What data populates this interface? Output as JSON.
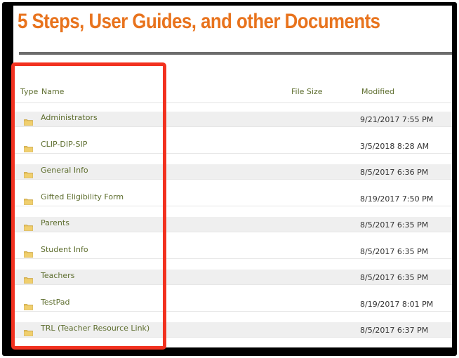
{
  "page": {
    "title": "5 Steps, User Guides, and other Documents"
  },
  "table": {
    "headers": {
      "type": "Type",
      "name": "Name",
      "file_size": "File Size",
      "modified": "Modified"
    },
    "rows": [
      {
        "icon": "folder-icon",
        "name": "Administrators",
        "file_size": "",
        "modified": "9/21/2017 7:55 PM"
      },
      {
        "icon": "folder-icon",
        "name": "CLIP-DIP-SIP",
        "file_size": "",
        "modified": "3/5/2018 8:28 AM"
      },
      {
        "icon": "folder-icon",
        "name": "General Info",
        "file_size": "",
        "modified": "8/5/2017 6:36 PM"
      },
      {
        "icon": "folder-icon",
        "name": "Gifted Eligibility Form",
        "file_size": "",
        "modified": "8/19/2017 7:50 PM"
      },
      {
        "icon": "folder-icon",
        "name": "Parents",
        "file_size": "",
        "modified": "8/5/2017 6:35 PM"
      },
      {
        "icon": "folder-icon",
        "name": "Student Info",
        "file_size": "",
        "modified": "8/5/2017 6:35 PM"
      },
      {
        "icon": "folder-icon",
        "name": "Teachers",
        "file_size": "",
        "modified": "8/5/2017 6:35 PM"
      },
      {
        "icon": "folder-icon",
        "name": "TestPad",
        "file_size": "",
        "modified": "8/19/2017 8:01 PM"
      },
      {
        "icon": "folder-icon",
        "name": "TRL (Teacher Resource Link)",
        "file_size": "",
        "modified": "8/5/2017 6:37 PM"
      }
    ]
  },
  "colors": {
    "title": "#e8731d",
    "link": "#5e6e2f",
    "highlight_box": "#f2311f",
    "frame": "#000000",
    "folder": "#e6c15c"
  }
}
